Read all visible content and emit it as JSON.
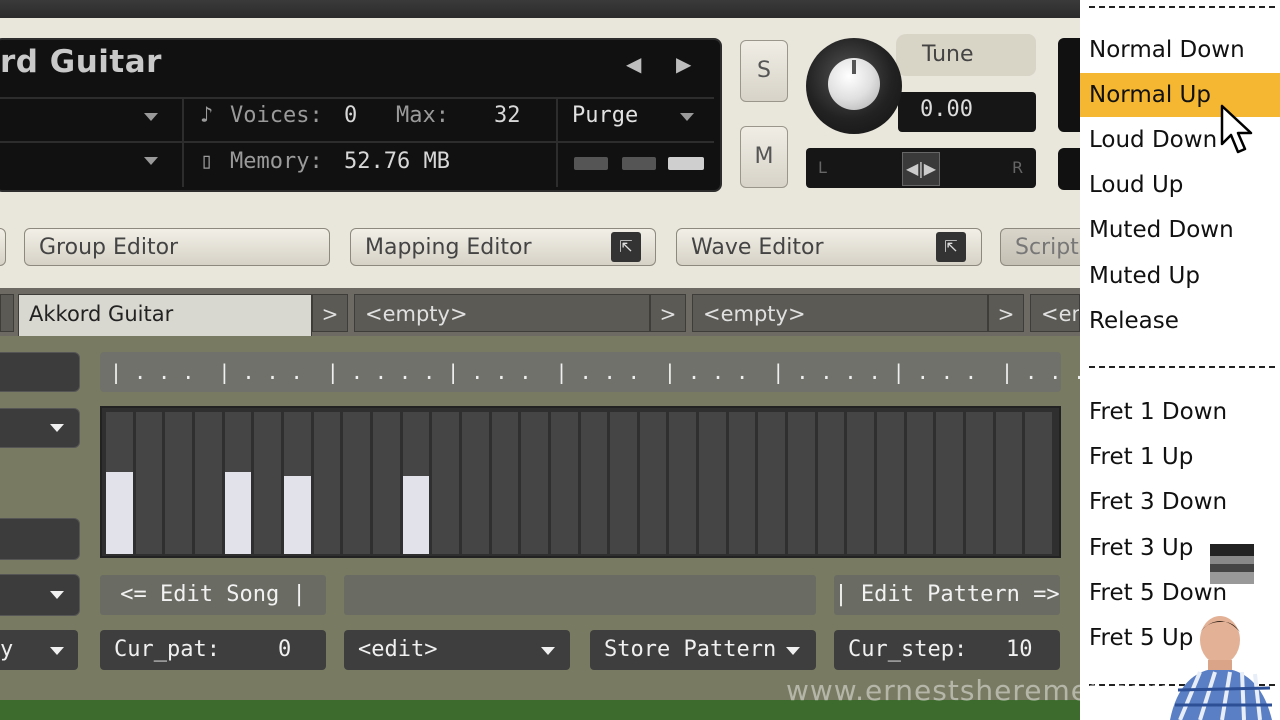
{
  "instrument": {
    "name": "rd Guitar",
    "voices_label": "Voices:",
    "voices_value": "0",
    "max_label": "Max:",
    "max_value": "32",
    "purge_label": "Purge",
    "memory_label": "Memory:",
    "memory_value": "52.76 MB",
    "prev_arrow": "◀",
    "next_arrow": "▶"
  },
  "side_buttons": {
    "solo": "S",
    "mute": "M"
  },
  "tune": {
    "label": "Tune",
    "value": "0.00",
    "pan_left": "L",
    "pan_right": "R"
  },
  "editor_tabs": [
    {
      "label": "Group Editor"
    },
    {
      "label": "Mapping Editor"
    },
    {
      "label": "Wave Editor"
    },
    {
      "label": "Script"
    }
  ],
  "groups": [
    {
      "label": "Akkord Guitar"
    },
    {
      "label": "<empty>"
    },
    {
      "label": "<empty>"
    },
    {
      "label": "<em"
    }
  ],
  "group_arrow": ">",
  "ruler": "| . . .  | . . .  | . . . . | . . .  | . . .  | . . .  | . . . . | . . .  | . . .",
  "step_grid": {
    "steps": 32,
    "filled": [
      {
        "step": 1,
        "level": 0.58
      },
      {
        "step": 5,
        "level": 0.58
      },
      {
        "step": 7,
        "level": 0.55
      },
      {
        "step": 11,
        "level": 0.55
      }
    ]
  },
  "controls": {
    "edit_song": "<=  Edit Song |",
    "edit_pattern": "| Edit Pattern =>",
    "cur_pat_label": "Cur_pat:",
    "cur_pat_value": "0",
    "edit_select": "<edit>",
    "store_pattern": "Store Pattern",
    "cur_step_label": "Cur_step:",
    "cur_step_value": "10",
    "left_partial": "y"
  },
  "menu": {
    "items": [
      "Normal Down",
      "Normal Up",
      "Loud Down",
      "Loud Up",
      "Muted Down",
      "Muted Up",
      "Release",
      "Fret 1 Down",
      "Fret 1 Up",
      "Fret 3 Down",
      "Fret 3 Up",
      "Fret 5 Down",
      "Fret 5 Up"
    ],
    "highlighted": "Normal Up",
    "highlight_color": "#f5b731"
  },
  "watermark": "www.ernestsheremet.com",
  "colors": {
    "panel_bg": "#e9e6dc",
    "main_green": "#787a62",
    "step_fill": "#e2e2ea"
  }
}
